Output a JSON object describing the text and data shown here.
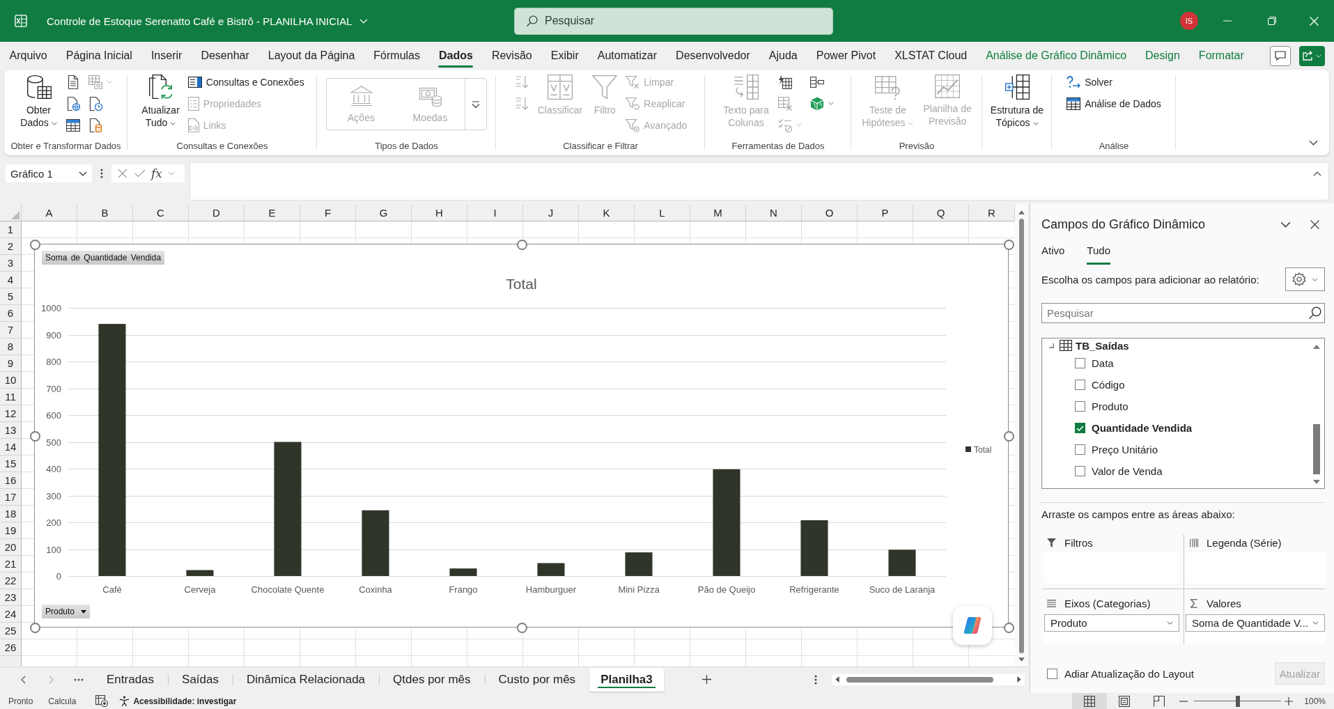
{
  "title_bar": {
    "title": "Controle de Estoque Serenatto Café e Bistrô - PLANILHA INICIAL",
    "search": {
      "placeholder": "Pesquisar"
    },
    "avatar": "IS"
  },
  "ribbon_tabs": [
    {
      "label": "Arquivo",
      "selected": false,
      "kind": "standard"
    },
    {
      "label": "Página Inicial",
      "selected": false,
      "kind": "standard"
    },
    {
      "label": "Inserir",
      "selected": false,
      "kind": "standard"
    },
    {
      "label": "Desenhar",
      "selected": false,
      "kind": "standard"
    },
    {
      "label": "Layout da Página",
      "selected": false,
      "kind": "standard"
    },
    {
      "label": "Fórmulas",
      "selected": false,
      "kind": "standard"
    },
    {
      "label": "Dados",
      "selected": true,
      "kind": "standard"
    },
    {
      "label": "Revisão",
      "selected": false,
      "kind": "standard"
    },
    {
      "label": "Exibir",
      "selected": false,
      "kind": "standard"
    },
    {
      "label": "Automatizar",
      "selected": false,
      "kind": "standard"
    },
    {
      "label": "Desenvolvedor",
      "selected": false,
      "kind": "standard"
    },
    {
      "label": "Ajuda",
      "selected": false,
      "kind": "standard"
    },
    {
      "label": "Power Pivot",
      "selected": false,
      "kind": "standard"
    },
    {
      "label": "XLSTAT Cloud",
      "selected": false,
      "kind": "standard"
    },
    {
      "label": "Análise de Gráfico Dinâmico",
      "selected": false,
      "kind": "contextual"
    },
    {
      "label": "Design",
      "selected": false,
      "kind": "contextual"
    },
    {
      "label": "Formatar",
      "selected": false,
      "kind": "contextual"
    }
  ],
  "ribbon": {
    "groups": [
      {
        "label": "Obter e Transformar Dados",
        "items": [
          {
            "kind": "large",
            "lines": [
              "Obter",
              "Dados"
            ],
            "dropdown": true,
            "disabled": false
          },
          {
            "kind": "icon",
            "dropdown": false,
            "disabled": false
          },
          {
            "kind": "icon",
            "dropdown": false,
            "disabled": false
          },
          {
            "kind": "icon",
            "dropdown": false,
            "disabled": false
          },
          {
            "kind": "icon",
            "dropdown": true,
            "disabled": true
          },
          {
            "kind": "icon",
            "dropdown": false,
            "disabled": false
          },
          {
            "kind": "icon",
            "dropdown": false,
            "disabled": false
          }
        ]
      },
      {
        "label": "Consultas e Conexões",
        "items": [
          {
            "kind": "large",
            "lines": [
              "Atualizar",
              "Tudo"
            ],
            "dropdown": true,
            "disabled": false
          },
          {
            "kind": "small",
            "label": "Consultas e Conexões",
            "dropdown": false,
            "disabled": false
          },
          {
            "kind": "small",
            "label": "Propriedades",
            "dropdown": false,
            "disabled": true
          },
          {
            "kind": "small",
            "label": "Links",
            "dropdown": false,
            "disabled": true
          }
        ]
      },
      {
        "label": "Tipos de Dados",
        "items": [
          {
            "kind": "gallery",
            "dropdown": true,
            "disabled": false,
            "options": [
              {
                "label": "Ações",
                "disabled": true
              },
              {
                "label": "Moedas",
                "disabled": true
              }
            ]
          }
        ]
      },
      {
        "label": "Classificar e Filtrar",
        "items": [
          {
            "kind": "icon",
            "dropdown": false,
            "disabled": true
          },
          {
            "kind": "icon",
            "dropdown": false,
            "disabled": true
          },
          {
            "kind": "large",
            "lines": [
              "Classificar"
            ],
            "dropdown": false,
            "disabled": true
          },
          {
            "kind": "large",
            "lines": [
              "Filtro"
            ],
            "dropdown": false,
            "disabled": true
          },
          {
            "kind": "small",
            "label": "Limpar",
            "dropdown": false,
            "disabled": true
          },
          {
            "kind": "small",
            "label": "Reaplicar",
            "dropdown": false,
            "disabled": true
          },
          {
            "kind": "small",
            "label": "Avançado",
            "dropdown": false,
            "disabled": true
          }
        ]
      },
      {
        "label": "Ferramentas de Dados",
        "items": [
          {
            "kind": "large",
            "lines": [
              "Texto para",
              "Colunas"
            ],
            "dropdown": false,
            "disabled": true
          },
          {
            "kind": "icon",
            "dropdown": false,
            "disabled": false
          },
          {
            "kind": "icon",
            "dropdown": false,
            "disabled": true
          },
          {
            "kind": "icon",
            "dropdown": true,
            "disabled": true
          },
          {
            "kind": "icon",
            "dropdown": false,
            "disabled": false
          },
          {
            "kind": "icon",
            "dropdown": true,
            "disabled": false
          }
        ]
      },
      {
        "label": "Previsão",
        "items": [
          {
            "kind": "large",
            "lines": [
              "Teste de",
              "Hipóteses"
            ],
            "dropdown": true,
            "disabled": true
          },
          {
            "kind": "large",
            "lines": [
              "Planilha de",
              "Previsão"
            ],
            "dropdown": false,
            "disabled": true
          }
        ]
      },
      {
        "items": [
          {
            "kind": "large",
            "lines": [
              "Estrutura de",
              "Tópicos"
            ],
            "dropdown": true,
            "disabled": false
          }
        ]
      },
      {
        "label": "Análise",
        "items": [
          {
            "kind": "small",
            "label": "Solver",
            "dropdown": false,
            "disabled": false
          },
          {
            "kind": "small",
            "label": "Análise de Dados",
            "dropdown": false,
            "disabled": false
          }
        ]
      }
    ]
  },
  "formula_bar": {
    "name_box": "Gráfico 1",
    "function_button": "fx"
  },
  "sheet": {
    "columns": [
      "A",
      "B",
      "C",
      "D",
      "E",
      "F",
      "G",
      "H",
      "I",
      "J",
      "K",
      "L",
      "M",
      "N",
      "O",
      "P",
      "Q",
      "R"
    ],
    "rows": [
      "1",
      "2",
      "3",
      "4",
      "5",
      "6",
      "7",
      "8",
      "9",
      "10",
      "11",
      "12",
      "13",
      "14",
      "15",
      "16",
      "17",
      "18",
      "19",
      "20",
      "21",
      "22",
      "23",
      "24",
      "25",
      "26"
    ]
  },
  "chart": {
    "value_field_button": "Soma de Quantidade Vendida",
    "axis_field_button": "Produto",
    "chart_data": {
      "type": "bar",
      "title": "Total",
      "grid": true,
      "categories": [
        "Café",
        "Cerveja",
        "Chocolate Quente",
        "Coxinha",
        "Frango",
        "Hamburguer",
        "Mini Pizza",
        "Pão de Queijo",
        "Refrigerante",
        "Suco de Laranja"
      ],
      "series": [
        {
          "name": "Total",
          "color": "#30352a",
          "values": [
            940,
            22,
            500,
            245,
            28,
            48,
            88,
            398,
            208,
            98
          ]
        }
      ],
      "ylim": [
        0,
        1000
      ],
      "yticks": [
        0,
        100,
        200,
        300,
        400,
        500,
        600,
        700,
        800,
        900,
        1000
      ]
    }
  },
  "sheet_tabs": [
    {
      "label": "Entradas",
      "selected": false
    },
    {
      "label": "Saídas",
      "selected": false
    },
    {
      "label": "Dinâmica Relacionada",
      "selected": false
    },
    {
      "label": "Qtdes por mês",
      "selected": false
    },
    {
      "label": "Custo por mês",
      "selected": false
    },
    {
      "label": "Planilha3",
      "selected": true
    }
  ],
  "pivot_pane": {
    "title": "Campos do Gráfico Dinâmico",
    "tabs": [
      {
        "label": "Ativo",
        "selected": false
      },
      {
        "label": "Tudo",
        "selected": true
      }
    ],
    "instruction": "Escolha os campos para adicionar ao relatório:",
    "search": {
      "placeholder": "Pesquisar"
    },
    "table": {
      "name": "TB_Saídas",
      "expanded": true,
      "fields": [
        {
          "label": "Data",
          "checked": false
        },
        {
          "label": "Código",
          "checked": false
        },
        {
          "label": "Produto",
          "checked": false
        },
        {
          "label": "Quantidade Vendida",
          "checked": true
        },
        {
          "label": "Preço Unitário",
          "checked": false
        },
        {
          "label": "Valor de Venda",
          "checked": false
        }
      ]
    },
    "areas_hint": "Arraste os campos entre as áreas abaixo:",
    "areas": [
      {
        "kind": "filters",
        "label": "Filtros"
      },
      {
        "kind": "legend",
        "label": "Legenda (Série)"
      },
      {
        "kind": "axis",
        "label": "Eixos (Categorias)",
        "items": [
          "Produto"
        ]
      },
      {
        "kind": "values",
        "label": "Valores",
        "items": [
          "Soma de Quantidade V..."
        ]
      }
    ],
    "defer_update": {
      "label": "Adiar Atualização do Layout",
      "checked": false
    },
    "update_button": {
      "label": "Atualizar",
      "disabled": true
    }
  },
  "status_bar": {
    "mode": "Pronto",
    "calculation": "Calcula",
    "accessibility": "Acessibilidade: investigar",
    "views": [
      {
        "kind": "normal",
        "selected": true
      },
      {
        "kind": "layout",
        "selected": false
      },
      {
        "kind": "pagebreak",
        "selected": false
      }
    ],
    "zoom": {
      "level": 0.5,
      "reading": "100%"
    }
  }
}
